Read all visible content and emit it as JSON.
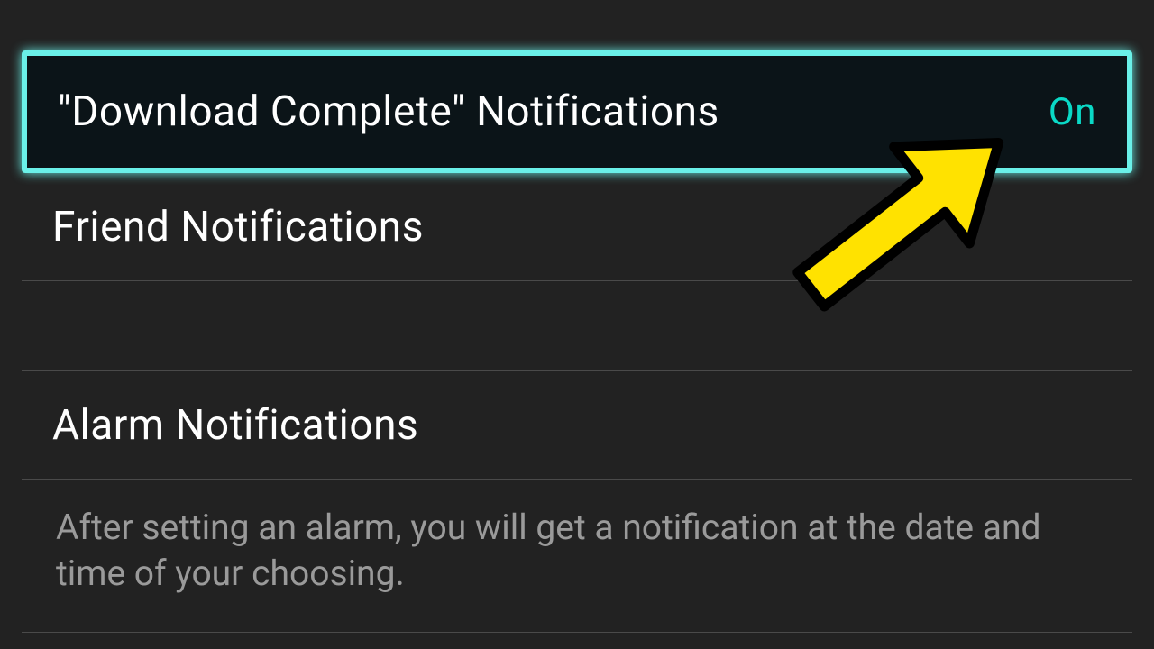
{
  "rows": {
    "download": {
      "label": "\"Download Complete\" Notifications",
      "value": "On"
    },
    "friend": {
      "label": "Friend Notifications"
    },
    "alarm": {
      "label": "Alarm Notifications",
      "description": "After setting an alarm, you will get a notification at the date and time of your choosing."
    }
  }
}
